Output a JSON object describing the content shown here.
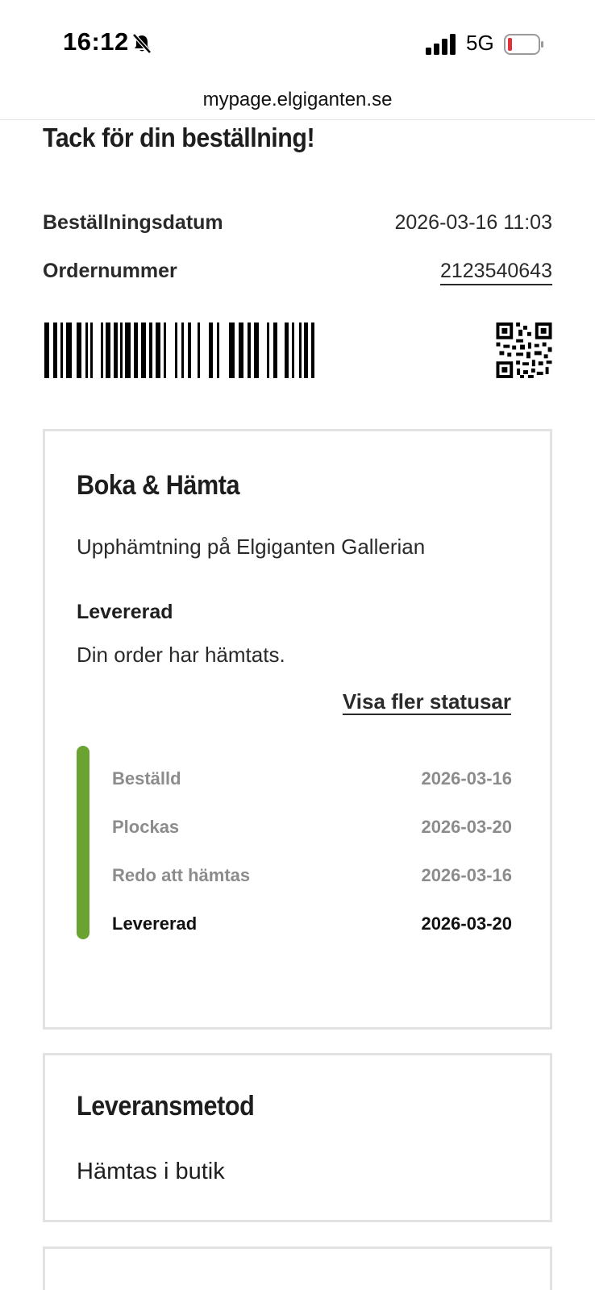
{
  "status_bar": {
    "time": "16:12",
    "network": "5G",
    "battery_color": "#e0303a"
  },
  "browser": {
    "url": "mypage.elgiganten.se"
  },
  "page": {
    "title": "Tack för din beställning!"
  },
  "order_info": {
    "date_label": "Beställningsdatum",
    "date_value": "2026-03-16 11:03",
    "number_label": "Ordernummer",
    "number_value": "2123540643"
  },
  "pickup_card": {
    "title": "Boka & Hämta",
    "location": "Upphämtning på Elgiganten Gallerian",
    "status_title": "Levererad",
    "status_text": "Din order har hämtats.",
    "more_link": "Visa fler statusar",
    "progress_color": "#6aa332",
    "steps": [
      {
        "label": "Beställd",
        "date": "2026-03-16",
        "state": "done"
      },
      {
        "label": "Plockas",
        "date": "2026-03-20",
        "state": "done"
      },
      {
        "label": "Redo att hämtas",
        "date": "2026-03-16",
        "state": "done"
      },
      {
        "label": "Levererad",
        "date": "2026-03-20",
        "state": "current"
      }
    ]
  },
  "delivery_card": {
    "title": "Leveransmetod",
    "value": "Hämtas i butik"
  },
  "icons": {
    "bell": "bell-slash-icon",
    "signal": "cellular-signal-icon",
    "battery": "battery-low-icon",
    "barcode": "barcode-icon",
    "qr": "qr-code-icon"
  }
}
